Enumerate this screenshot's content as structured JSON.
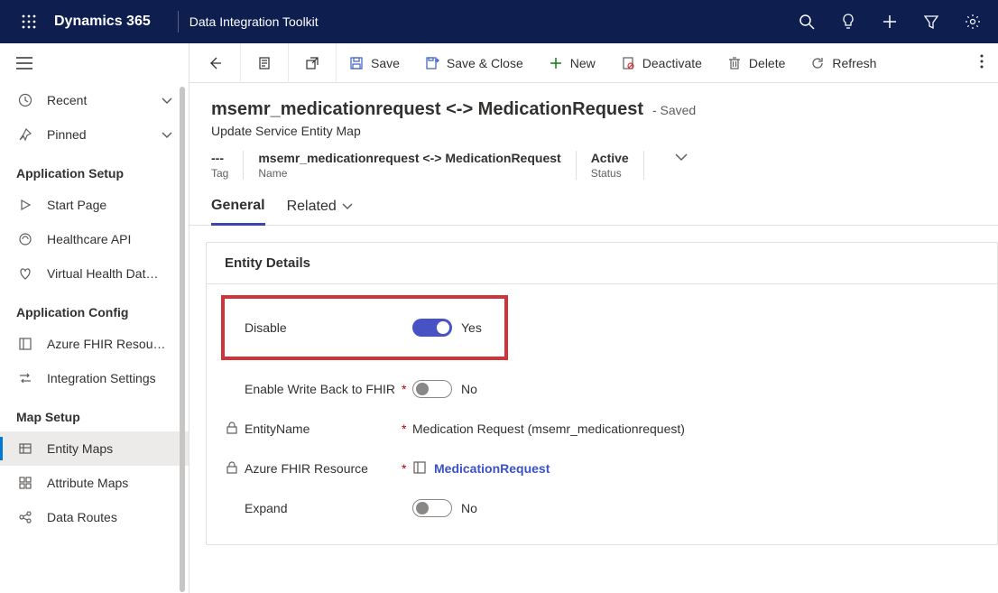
{
  "topbar": {
    "brand": "Dynamics 365",
    "app": "Data Integration Toolkit"
  },
  "sidebar": {
    "recent": "Recent",
    "pinned": "Pinned",
    "groups": {
      "app_setup": "Application Setup",
      "app_config": "Application Config",
      "map_setup": "Map Setup"
    },
    "items": {
      "start_page": "Start Page",
      "healthcare_api": "Healthcare API",
      "virtual_health": "Virtual Health Dat…",
      "azure_fhir": "Azure FHIR Resou…",
      "integration": "Integration Settings",
      "entity_maps": "Entity Maps",
      "attribute_maps": "Attribute Maps",
      "data_routes": "Data Routes"
    }
  },
  "cmdbar": {
    "save": "Save",
    "save_close": "Save & Close",
    "new": "New",
    "deactivate": "Deactivate",
    "delete": "Delete",
    "refresh": "Refresh"
  },
  "record": {
    "title": "msemr_medicationrequest <-> MedicationRequest",
    "saved": "- Saved",
    "subtitle": "Update Service Entity Map",
    "meta": {
      "tag_value": "---",
      "tag_label": "Tag",
      "name_value": "msemr_medicationrequest <-> MedicationRequest",
      "name_label": "Name",
      "status_value": "Active",
      "status_label": "Status"
    }
  },
  "tabs": {
    "general": "General",
    "related": "Related"
  },
  "panel": {
    "title": "Entity Details",
    "fields": {
      "disable": {
        "label": "Disable",
        "value": "Yes"
      },
      "writeback": {
        "label": "Enable Write Back to FHIR",
        "value": "No"
      },
      "entityname": {
        "label": "EntityName",
        "value": "Medication Request (msemr_medicationrequest)"
      },
      "azure": {
        "label": "Azure FHIR Resource",
        "value": "MedicationRequest"
      },
      "expand": {
        "label": "Expand",
        "value": "No"
      }
    }
  }
}
